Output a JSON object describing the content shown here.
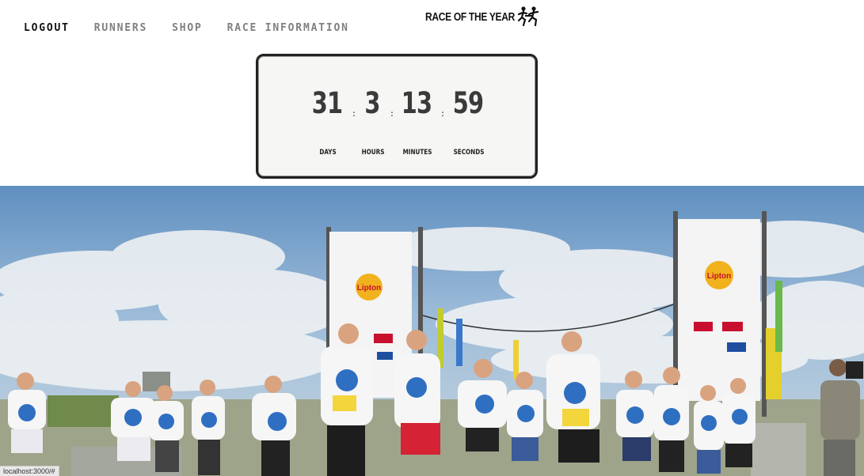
{
  "nav": {
    "items": [
      {
        "label": "LOGOUT",
        "active": true
      },
      {
        "label": "RUNNERS",
        "active": false
      },
      {
        "label": "SHOP",
        "active": false
      },
      {
        "label": "RACE INFORMATION",
        "active": false
      }
    ]
  },
  "logo": {
    "text": "RACE OF THE YEAR",
    "icon": "runners-icon"
  },
  "countdown": {
    "days": {
      "value": "31",
      "label": "DAYS"
    },
    "hours": {
      "value": "3",
      "label": "HOURS"
    },
    "minutes": {
      "value": "13",
      "label": "MINUTES"
    },
    "seconds": {
      "value": "59",
      "label": "SECONDS"
    },
    "separator": ":"
  },
  "hero": {
    "description_image": "runners-start-photo",
    "banner_brand_left": "Lipton",
    "banner_brand_right": "Lipton"
  },
  "status_bar": {
    "url": "localhost:3000/#"
  },
  "colors": {
    "nav_active": "#111111",
    "nav_inactive": "#808080",
    "countdown_digits": "#3a3a3a",
    "sky": "#8fb4d6"
  }
}
